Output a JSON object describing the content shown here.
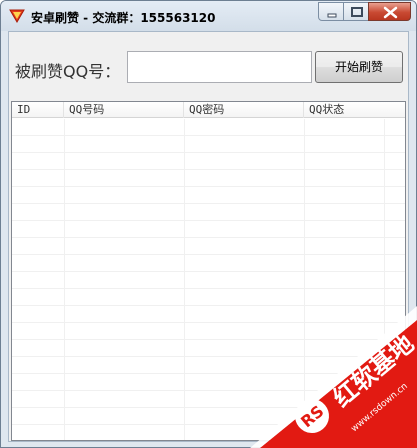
{
  "window": {
    "title": "安卓刷赞 - 交流群：155563120",
    "icon": "app-logo-icon"
  },
  "form": {
    "qq_label": "被刷赞QQ号：",
    "qq_value": "",
    "start_button": "开始刷赞"
  },
  "table": {
    "columns": [
      "ID",
      "QQ号码",
      "QQ密码",
      "QQ状态"
    ],
    "rows": []
  },
  "watermark": {
    "brand": "红软基地",
    "url": "www.rsdown.cn",
    "colors": {
      "banner": "#e21a12",
      "text": "#ffffff"
    }
  },
  "colors": {
    "close_button": "#c94a33",
    "client_bg": "#f0f0f0"
  }
}
